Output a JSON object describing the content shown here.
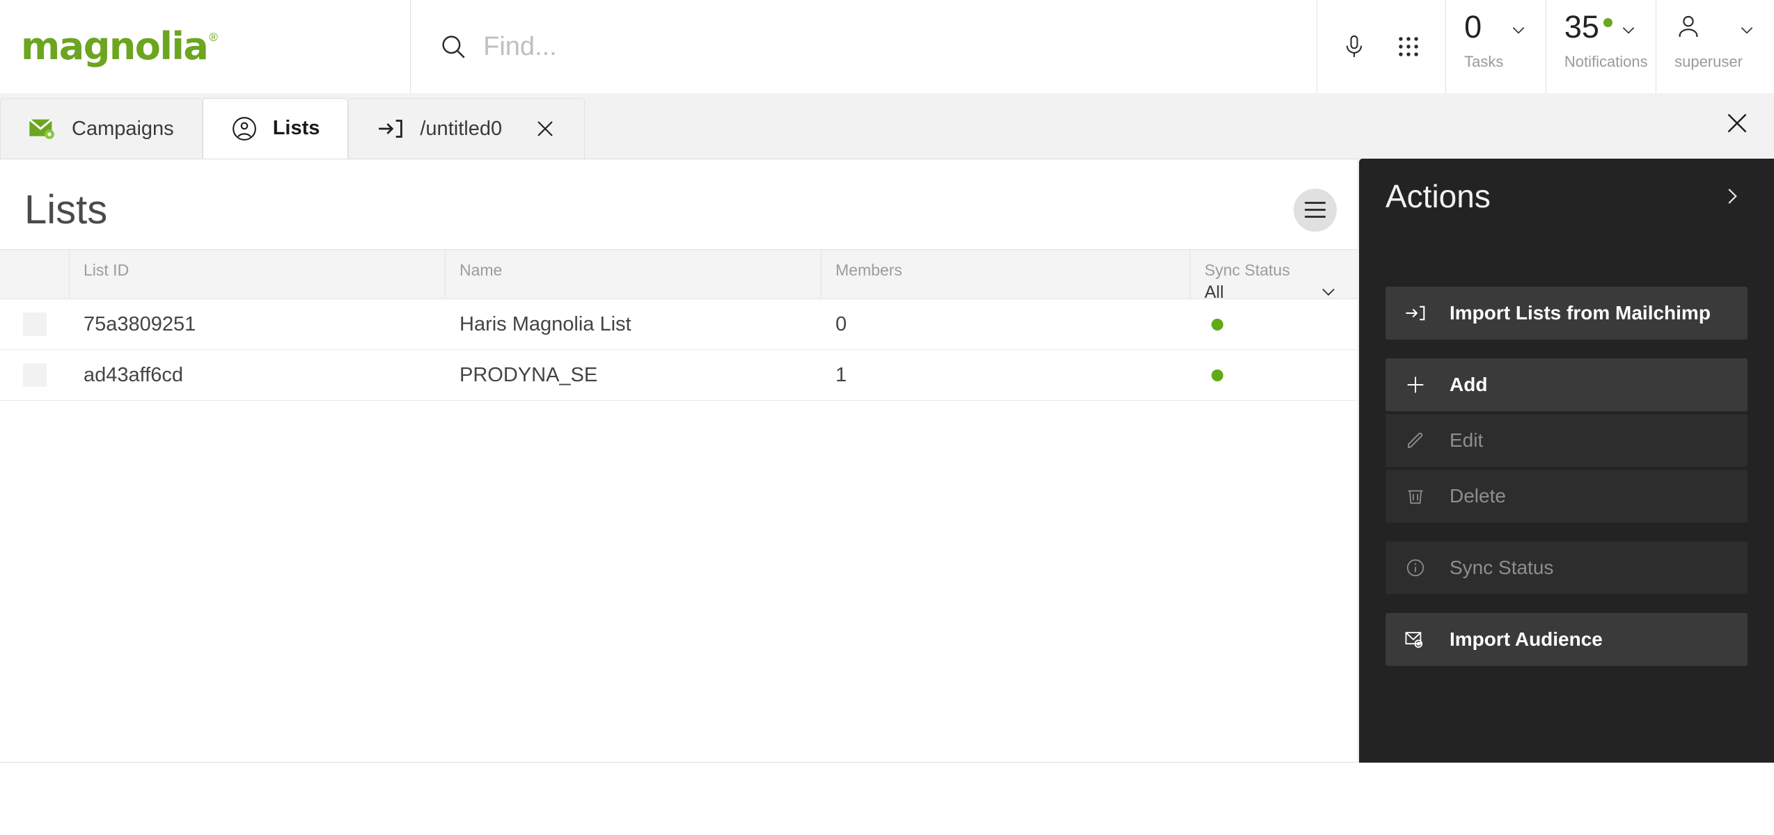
{
  "brand": {
    "name": "magnolia",
    "registered": "®",
    "color": "#6ca520"
  },
  "search": {
    "placeholder": "Find...",
    "icon": "search-icon"
  },
  "header_tools": {
    "mic_icon": "microphone-icon",
    "apps_icon": "apps-grid-icon",
    "tasks": {
      "count": "0",
      "label": "Tasks"
    },
    "notifications": {
      "count": "35",
      "label": "Notifications",
      "dot_color": "#6ca520"
    },
    "user": {
      "label": "superuser",
      "icon": "user-icon"
    }
  },
  "tabs": [
    {
      "label": "Campaigns",
      "icon": "envelope-gear-icon",
      "active": false,
      "closable": false
    },
    {
      "label": "Lists",
      "icon": "user-circle-icon",
      "active": true,
      "closable": false
    },
    {
      "label": "/untitled0",
      "icon": "import-arrow-icon",
      "active": false,
      "closable": true
    }
  ],
  "tabbar": {
    "close_all_icon": "close-icon"
  },
  "main": {
    "page_title": "Lists",
    "view_toggle_icon": "hamburger-icon",
    "table": {
      "columns": [
        {
          "key": "check",
          "label": ""
        },
        {
          "key": "list_id",
          "label": "List ID"
        },
        {
          "key": "name",
          "label": "Name"
        },
        {
          "key": "members",
          "label": "Members"
        },
        {
          "key": "sync_status",
          "label": "Sync Status",
          "filter_value": "All"
        }
      ],
      "rows": [
        {
          "list_id": "75a3809251",
          "name": "Haris Magnolia List",
          "members": "0",
          "sync_status_color": "#60a917"
        },
        {
          "list_id": "ad43aff6cd",
          "name": "PRODYNA_SE",
          "members": "1",
          "sync_status_color": "#60a917"
        }
      ]
    }
  },
  "actions": {
    "title": "Actions",
    "collapse_icon": "chevron-right-icon",
    "items": [
      {
        "label": "Import Lists from Mailchimp",
        "icon": "import-arrow-icon",
        "enabled": true
      },
      {
        "label": "Add",
        "icon": "plus-icon",
        "enabled": true
      },
      {
        "label": "Edit",
        "icon": "pencil-icon",
        "enabled": false
      },
      {
        "label": "Delete",
        "icon": "trash-icon",
        "enabled": false
      },
      {
        "label": "Sync Status",
        "icon": "info-icon",
        "enabled": false
      },
      {
        "label": "Import Audience",
        "icon": "envelope-gear-icon",
        "enabled": true
      }
    ]
  }
}
